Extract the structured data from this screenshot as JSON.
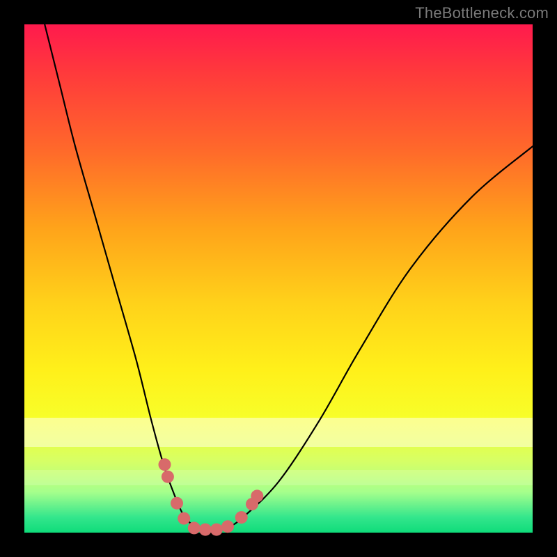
{
  "watermark": "TheBottleneck.com",
  "chart_data": {
    "type": "line",
    "title": "",
    "xlabel": "",
    "ylabel": "",
    "xlim": [
      0,
      100
    ],
    "ylim": [
      0,
      100
    ],
    "grid": false,
    "legend": false,
    "series": [
      {
        "name": "bottleneck-curve",
        "x": [
          4,
          7,
          10,
          14,
          18,
          22,
          25,
          27.5,
          29.5,
          31,
          32.5,
          34,
          36,
          38,
          40,
          43,
          50,
          58,
          66,
          76,
          88,
          100
        ],
        "y": [
          100,
          88,
          76,
          62,
          48,
          34,
          22,
          13,
          7.5,
          4,
          2,
          1,
          0.5,
          0.5,
          1,
          3,
          10,
          22,
          36,
          52,
          66,
          76
        ]
      }
    ],
    "markers": {
      "name": "highlight-dots",
      "color": "#d86a6a",
      "points": [
        {
          "x": 27.6,
          "y": 13.4
        },
        {
          "x": 28.2,
          "y": 11.0
        },
        {
          "x": 30.0,
          "y": 5.8
        },
        {
          "x": 31.4,
          "y": 2.8
        },
        {
          "x": 33.4,
          "y": 0.9
        },
        {
          "x": 35.6,
          "y": 0.6
        },
        {
          "x": 37.8,
          "y": 0.6
        },
        {
          "x": 40.0,
          "y": 1.2
        },
        {
          "x": 42.7,
          "y": 3.0
        },
        {
          "x": 44.8,
          "y": 5.6
        },
        {
          "x": 45.8,
          "y": 7.2
        }
      ]
    },
    "gradient_stops": [
      {
        "pos": 0,
        "color": "#ff1a4d"
      },
      {
        "pos": 25,
        "color": "#ff6a2a"
      },
      {
        "pos": 55,
        "color": "#ffd21a"
      },
      {
        "pos": 78,
        "color": "#f7ff2a"
      },
      {
        "pos": 100,
        "color": "#0fdc7a"
      }
    ]
  }
}
